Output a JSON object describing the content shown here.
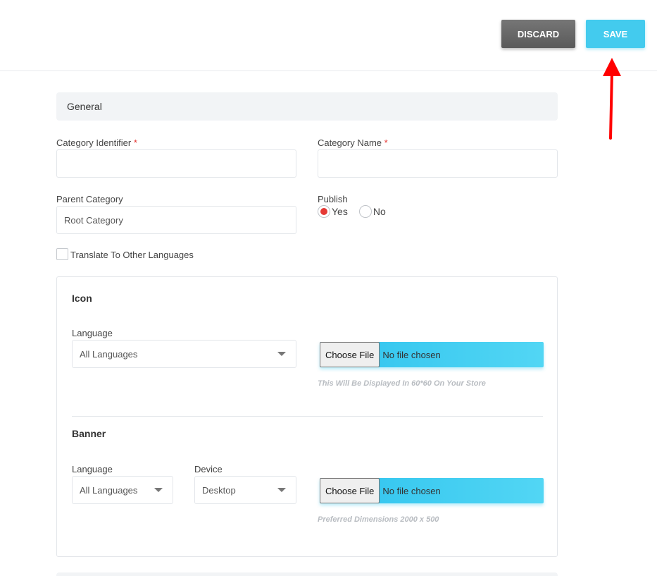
{
  "toolbar": {
    "discard_label": "DISCARD",
    "save_label": "SAVE"
  },
  "general": {
    "header": "General",
    "category_identifier_label": "Category Identifier",
    "category_name_label": "Category Name",
    "required_mark": "*",
    "parent_category_label": "Parent Category",
    "parent_category_value": "Root Category",
    "publish_label": "Publish",
    "publish_yes": "Yes",
    "publish_no": "No",
    "translate_label": "Translate To Other Languages"
  },
  "icon_section": {
    "title": "Icon",
    "language_label": "Language",
    "language_value": "All Languages",
    "choose_file_label": "Choose File",
    "file_status": "No file chosen",
    "hint": "This Will Be Displayed In 60*60 On Your Store"
  },
  "banner_section": {
    "title": "Banner",
    "language_label": "Language",
    "language_value": "All Languages",
    "device_label": "Device",
    "device_value": "Desktop",
    "choose_file_label": "Choose File",
    "file_status": "No file chosen",
    "hint": "Preferred Dimensions 2000 x 500"
  },
  "colors": {
    "accent": "#43cbee",
    "discard": "#666666",
    "required": "#e53935",
    "annotation_arrow": "#ff0000"
  }
}
